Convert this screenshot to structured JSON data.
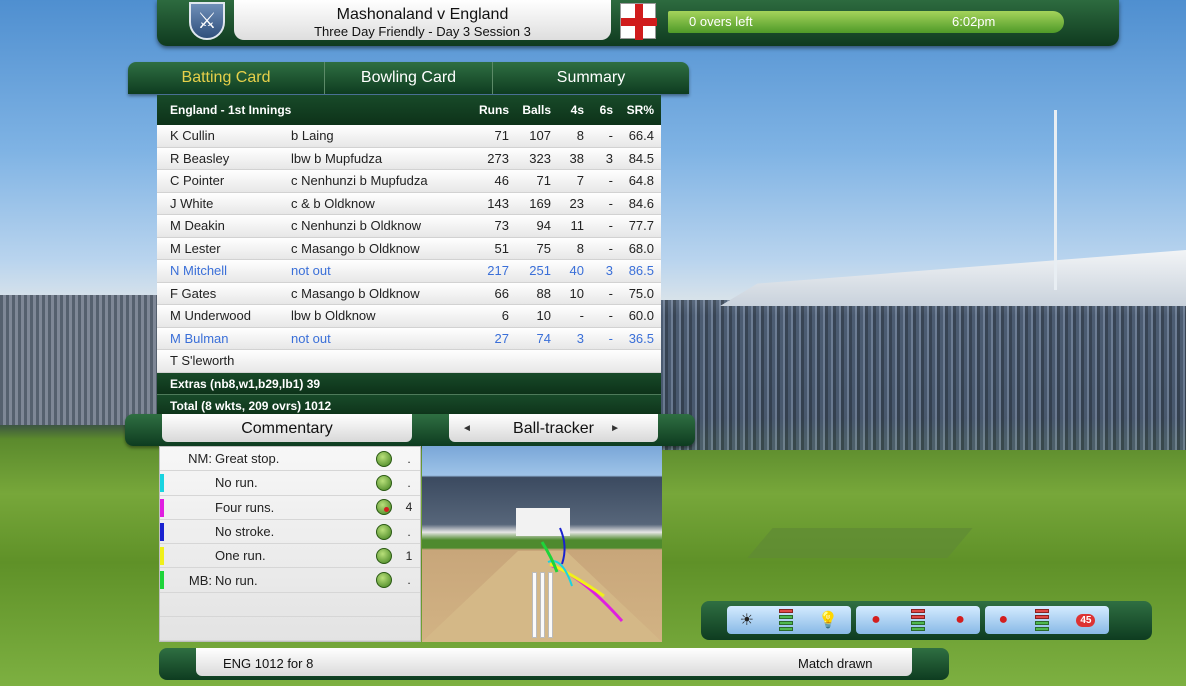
{
  "header": {
    "match_title": "Mashonaland v England",
    "match_subtitle": "Three Day Friendly - Day 3 Session 3",
    "overs_left": "0 overs left",
    "time": "6:02pm"
  },
  "tabs": [
    {
      "label": "Batting Card",
      "active": true
    },
    {
      "label": "Bowling Card",
      "active": false
    },
    {
      "label": "Summary",
      "active": false
    }
  ],
  "batting_card": {
    "innings": "England - 1st Innings",
    "columns": [
      "Runs",
      "Balls",
      "4s",
      "6s",
      "SR%"
    ],
    "rows": [
      {
        "name": "K Cullin",
        "how": "b Laing",
        "runs": "71",
        "balls": "107",
        "fours": "8",
        "sixes": "-",
        "sr": "66.4",
        "notout": false
      },
      {
        "name": "R Beasley",
        "how": "lbw b Mupfudza",
        "runs": "273",
        "balls": "323",
        "fours": "38",
        "sixes": "3",
        "sr": "84.5",
        "notout": false
      },
      {
        "name": "C Pointer",
        "how": "c Nenhunzi b Mupfudza",
        "runs": "46",
        "balls": "71",
        "fours": "7",
        "sixes": "-",
        "sr": "64.8",
        "notout": false
      },
      {
        "name": "J White",
        "how": "c & b Oldknow",
        "runs": "143",
        "balls": "169",
        "fours": "23",
        "sixes": "-",
        "sr": "84.6",
        "notout": false
      },
      {
        "name": "M Deakin",
        "how": "c Nenhunzi b Oldknow",
        "runs": "73",
        "balls": "94",
        "fours": "11",
        "sixes": "-",
        "sr": "77.7",
        "notout": false
      },
      {
        "name": "M Lester",
        "how": "c Masango b Oldknow",
        "runs": "51",
        "balls": "75",
        "fours": "8",
        "sixes": "-",
        "sr": "68.0",
        "notout": false
      },
      {
        "name": "N Mitchell",
        "how": "not out",
        "runs": "217",
        "balls": "251",
        "fours": "40",
        "sixes": "3",
        "sr": "86.5",
        "notout": true
      },
      {
        "name": "F Gates",
        "how": "c Masango b Oldknow",
        "runs": "66",
        "balls": "88",
        "fours": "10",
        "sixes": "-",
        "sr": "75.0",
        "notout": false
      },
      {
        "name": "M Underwood",
        "how": "lbw b Oldknow",
        "runs": "6",
        "balls": "10",
        "fours": "-",
        "sixes": "-",
        "sr": "60.0",
        "notout": false
      },
      {
        "name": "M Bulman",
        "how": "not out",
        "runs": "27",
        "balls": "74",
        "fours": "3",
        "sixes": "-",
        "sr": "36.5",
        "notout": true
      },
      {
        "name": "T S'leworth",
        "how": "",
        "runs": "",
        "balls": "",
        "fours": "",
        "sixes": "",
        "sr": "",
        "notout": false
      }
    ],
    "extras": "Extras (nb8,w1,b29,lb1) 39",
    "total": "Total (8 wkts, 209 ovrs) 1012"
  },
  "panels": {
    "commentary_label": "Commentary",
    "tracker_label": "Ball-tracker",
    "prev_arrow": "◄",
    "next_arrow": "►"
  },
  "commentary": [
    {
      "who": "NM:",
      "text": "Great stop.",
      "runs": ".",
      "color": "",
      "hit": false
    },
    {
      "who": "",
      "text": "No run.",
      "runs": ".",
      "color": "#19d4e0",
      "hit": false
    },
    {
      "who": "",
      "text": "Four runs.",
      "runs": "4",
      "color": "#e01ee0",
      "hit": true
    },
    {
      "who": "",
      "text": "No stroke.",
      "runs": ".",
      "color": "#1a22d0",
      "hit": false
    },
    {
      "who": "",
      "text": "One run.",
      "runs": "1",
      "color": "#f0f01a",
      "hit": false
    },
    {
      "who": "MB:",
      "text": "No run.",
      "runs": ".",
      "color": "#1ed43a",
      "hit": false
    }
  ],
  "conditions": {
    "weather_icon": "sun-icon",
    "light_icon": "lightbulb-icon",
    "ball_icon": "cricket-ball-icon",
    "ball_count": "45"
  },
  "footer": {
    "score": "ENG  1012 for 8",
    "result": "Match drawn"
  }
}
